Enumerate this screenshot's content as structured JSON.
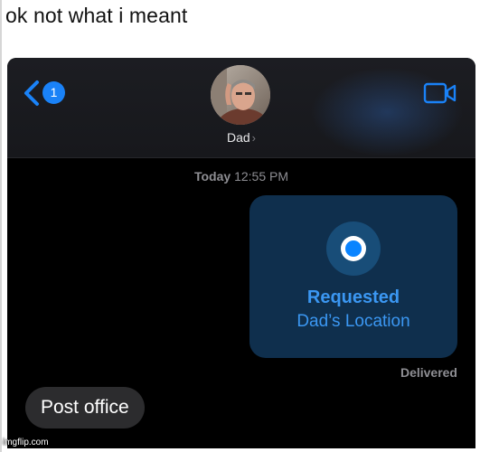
{
  "caption": "ok not what i meant",
  "header": {
    "back_badge_count": "1",
    "contact_name": "Dad",
    "contact_chevron": "›",
    "icons": {
      "back": "chevron-left-icon",
      "video": "video-camera-icon"
    },
    "accent_color": "#1a82f7"
  },
  "conversation": {
    "timestamp_day": "Today",
    "timestamp_time": "12:55 PM",
    "location_request": {
      "title": "Requested",
      "subtitle": "Dad’s Location",
      "icon": "location-dot-icon",
      "bubble_color": "#0f2f4d",
      "text_color": "#3b97f2"
    },
    "status": "Delivered",
    "incoming_message": "Post office"
  },
  "watermark": "imgflip.com"
}
